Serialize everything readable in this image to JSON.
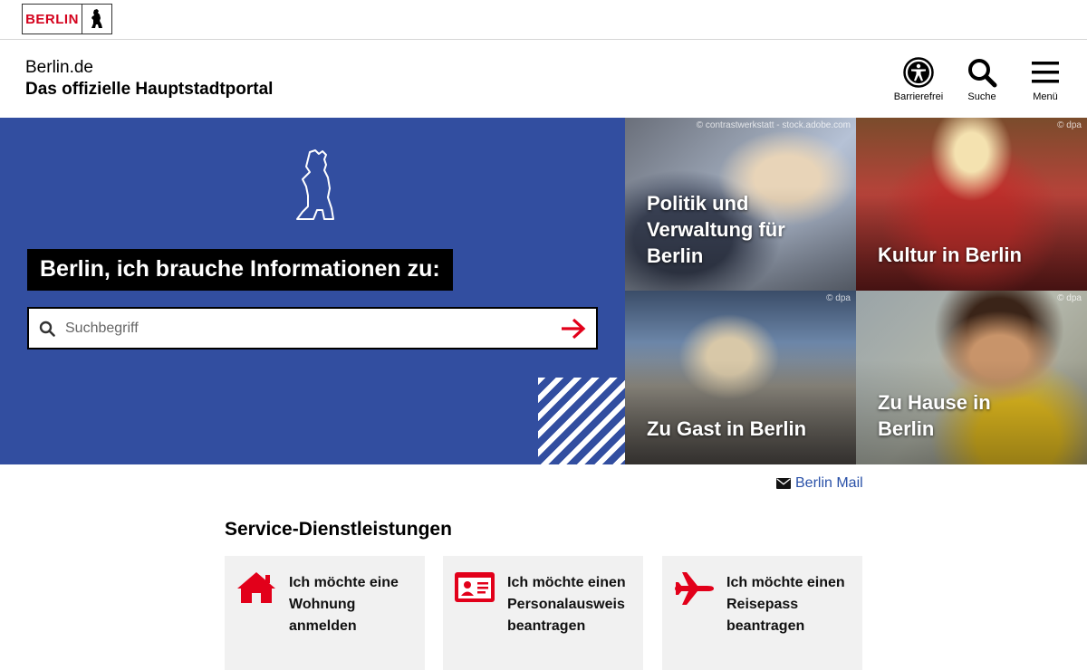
{
  "logo": {
    "text": "BERLIN"
  },
  "header": {
    "site_name": "Berlin.de",
    "tagline": "Das offizielle Hauptstadtportal",
    "tools": {
      "accessibility": "Barrierefrei",
      "search": "Suche",
      "menu": "Menü"
    }
  },
  "hero": {
    "title": "Berlin, ich brauche Informationen zu:",
    "search_placeholder": "Suchbegriff",
    "background_color": "#324ea0"
  },
  "tiles": [
    {
      "title": "Politik und Verwaltung für Berlin",
      "credit": "© contrastwerkstatt - stock.adobe.com"
    },
    {
      "title": "Kultur in Berlin",
      "credit": "© dpa"
    },
    {
      "title": "Zu Gast in Berlin",
      "credit": "© dpa"
    },
    {
      "title": "Zu Hause in Berlin",
      "credit": "© dpa"
    }
  ],
  "mail": {
    "label": "Berlin Mail"
  },
  "services": {
    "title": "Service-Dienstleistungen",
    "accent_color": "#e2001a",
    "cards": [
      {
        "text": "Ich möchte eine Wohnung anmelden",
        "icon": "house-icon"
      },
      {
        "text": "Ich möchte einen Personalausweis beantragen",
        "icon": "id-card-icon"
      },
      {
        "text": "Ich möchte einen Reisepass beantragen",
        "icon": "airplane-icon"
      }
    ]
  }
}
